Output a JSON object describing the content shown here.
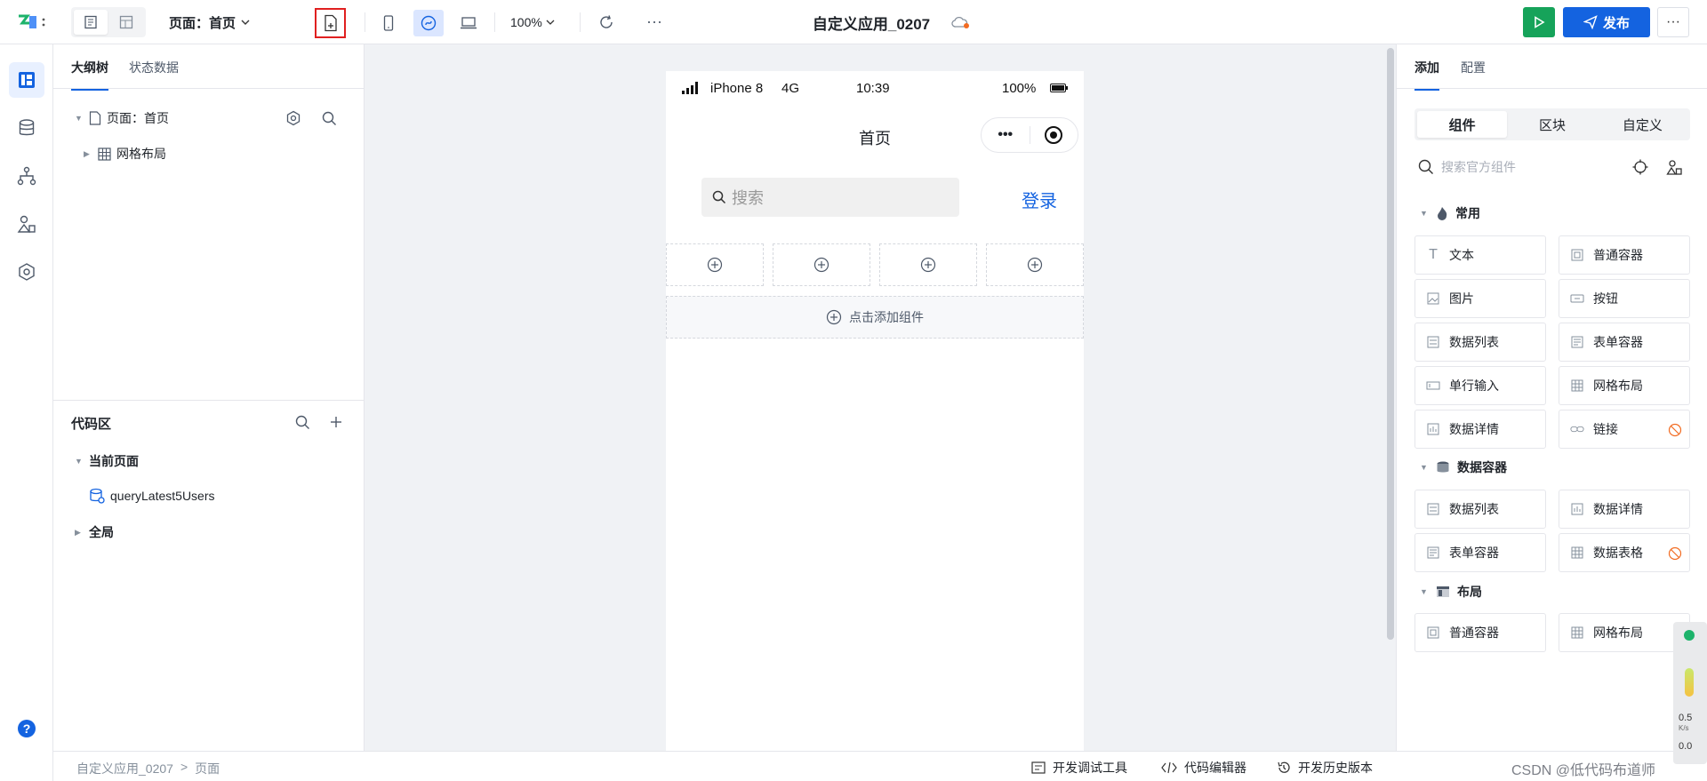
{
  "topbar": {
    "page_selector": "页面：首页",
    "zoom": "100%",
    "app_title": "自定义应用_0207",
    "publish_label": "发布",
    "more": "···"
  },
  "outline": {
    "tabs": [
      "大纲树",
      "状态数据"
    ],
    "tree": {
      "page_label": "页面：首页",
      "child_label": "网格布局"
    }
  },
  "code_area": {
    "title": "代码区",
    "current_page": "当前页面",
    "query": "queryLatest5Users",
    "global": "全局"
  },
  "phone": {
    "carrier": "iPhone 8",
    "network": "4G",
    "time": "10:39",
    "battery": "100%",
    "nav_title": "首页",
    "capsule_dots": "•••",
    "search_placeholder": "搜索",
    "login": "登录",
    "add_component": "点击添加组件"
  },
  "right_panel": {
    "tabs": [
      "添加",
      "配置"
    ],
    "segments": [
      "组件",
      "区块",
      "自定义"
    ],
    "search_placeholder": "搜索官方组件",
    "groups": [
      {
        "title": "常用",
        "items": [
          "文本",
          "普通容器",
          "图片",
          "按钮",
          "数据列表",
          "表单容器",
          "单行输入",
          "网格布局",
          "数据详情",
          "链接"
        ]
      },
      {
        "title": "数据容器",
        "items": [
          "数据列表",
          "数据详情",
          "表单容器",
          "数据表格"
        ]
      },
      {
        "title": "布局",
        "items": [
          "普通容器",
          "网格布局"
        ]
      }
    ]
  },
  "footer": {
    "crumb_app": "自定义应用_0207",
    "crumb_page": "页面",
    "sep": ">",
    "dev_tools": "开发调试工具",
    "code_editor": "代码编辑器",
    "history": "开发历史版本",
    "watermark": "CSDN @低代码布道师",
    "net_up": "0.5",
    "net_unit": "K/s",
    "net_down": "0.0"
  },
  "colors": {
    "accent": "#1463e0",
    "run": "#16a35a",
    "highlight_border": "#e02020"
  }
}
